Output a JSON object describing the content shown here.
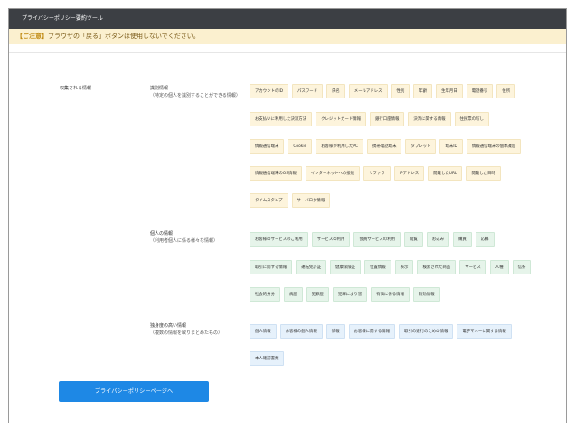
{
  "window": {
    "title": "プライバシーポリシー要約ツール"
  },
  "notice": {
    "tag": "【ご注意】",
    "text": "ブラウザの「戻る」ボタンは使用しないでください。"
  },
  "section": {
    "label": "収集される情報"
  },
  "categories": {
    "identification": {
      "title": "識別情報",
      "subtitle": "（特定の個人を識別することができる情報）",
      "rows": [
        [
          "アカウントのID",
          "パスワード",
          "氏名",
          "メールアドレス",
          "性別",
          "年齢",
          "生年月日",
          "電話番号",
          "住所"
        ],
        [
          "お支払いに利用した決済方法",
          "クレジットカード情報",
          "銀行口座情報",
          "決済に関する情報",
          "住民票の写し"
        ],
        [
          "情報通信端末",
          "Cookie",
          "お客様が利用したPC",
          "携帯電話端末",
          "タブレット",
          "端末ID",
          "情報通信端末の個体識別"
        ],
        [
          "情報通信端末のOS情報",
          "インターネットへの接続",
          "リファラ",
          "IPアドレス",
          "閲覧したURL",
          "閲覧した日時"
        ],
        [
          "タイムスタンプ",
          "サーバログ情報"
        ]
      ]
    },
    "personal": {
      "title": "個人の情報",
      "subtitle": "（利用者個人に係る様々な情報）",
      "rows": [
        [
          "お客様のサービスのご利用",
          "サービスの利用",
          "会員サービスの利用",
          "閲覧",
          "お込み",
          "購買",
          "応募"
        ],
        [
          "取引に関する情報",
          "運転免許証",
          "健康保険証",
          "位置情報",
          "表示",
          "検索された商品",
          "サービス",
          "人種",
          "信条"
        ],
        [
          "社会的身分",
          "病歴",
          "犯罪歴",
          "犯罪により害",
          "有価に係る情報",
          "有効情報"
        ]
      ]
    },
    "sensitive": {
      "title": "独身度の高い情報",
      "subtitle": "（複数の情報を取りまとめたもの）",
      "rows": [
        [
          "個人情報",
          "お客様の個人情報",
          "情報",
          "お客様に関する情報",
          "取引の遂行のための情報",
          "電子マネーに関する情報"
        ],
        [
          "本人確認書類"
        ]
      ]
    }
  },
  "button": {
    "label": "プライバシーポリシーページへ"
  },
  "colors": {
    "titlebar": "#3c3f44",
    "notice_bg": "#fbf0cf",
    "chip_identification": "#fdf4dc",
    "chip_personal": "#e6f4ea",
    "chip_sensitive": "#e6f1fb",
    "button": "#1e88e5"
  }
}
